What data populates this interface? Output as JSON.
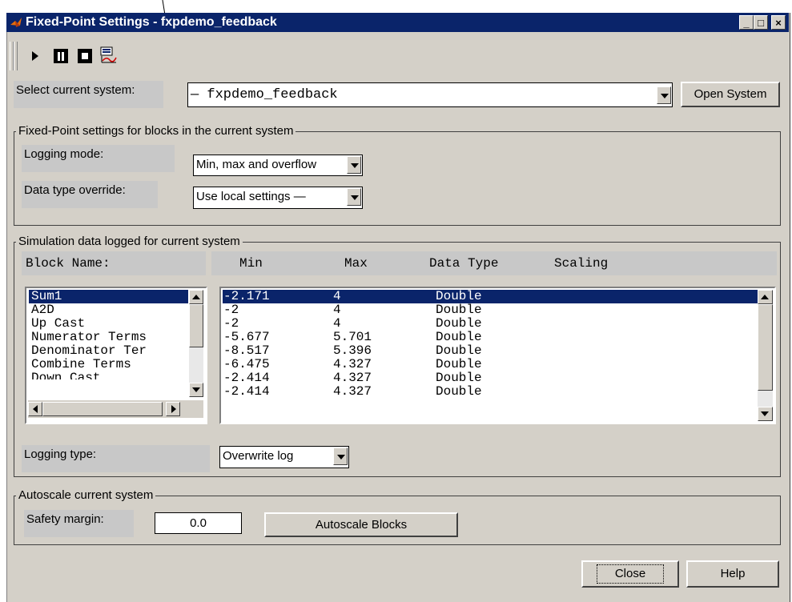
{
  "window": {
    "title": "Fixed-Point Settings - fxpdemo_feedback",
    "controls": [
      "_",
      "□",
      "×"
    ]
  },
  "toolbar": {
    "icons": [
      "play-icon",
      "pause-icon",
      "stop-icon",
      "plot-icon"
    ]
  },
  "system": {
    "label": "Select current system:",
    "value": "— fxpdemo_feedback",
    "open_button": "Open System"
  },
  "fixed_point_group": {
    "title": "Fixed-Point settings for blocks in the current system",
    "logging_mode_label": "Logging mode:",
    "logging_mode_value": "Min, max and overflow",
    "override_label": "Data type override:",
    "override_value": "Use local settings —"
  },
  "simulation_group": {
    "title": "Simulation data logged for current system",
    "block_name_header": "Block Name:",
    "columns": [
      "Min",
      "Max",
      "Data Type",
      "Scaling"
    ],
    "blocks": [
      "Sum1",
      "A2D",
      "Up Cast",
      "Numerator Terms",
      "Denominator Ter",
      "Combine Terms",
      "Down Cast"
    ],
    "rows": [
      {
        "min": "-2.171",
        "max": "4",
        "type": "Double"
      },
      {
        "min": "-2",
        "max": "4",
        "type": "Double"
      },
      {
        "min": "-2",
        "max": "4",
        "type": "Double"
      },
      {
        "min": "-5.677",
        "max": "5.701",
        "type": "Double"
      },
      {
        "min": "-8.517",
        "max": "5.396",
        "type": "Double"
      },
      {
        "min": "-6.475",
        "max": "4.327",
        "type": "Double"
      },
      {
        "min": "-2.414",
        "max": "4.327",
        "type": "Double"
      },
      {
        "min": "-2.414",
        "max": "4.327",
        "type": "Double"
      }
    ],
    "logging_type_label": "Logging type:",
    "logging_type_value": "Overwrite log"
  },
  "autoscale_group": {
    "title": "Autoscale current system",
    "safety_label": "Safety margin:",
    "safety_value": "0.0",
    "autoscale_button": "Autoscale Blocks"
  },
  "footer": {
    "close_button": "Close",
    "help_button": "Help"
  },
  "colors": {
    "titlebar": "#0a246a",
    "face": "#d4d0c8",
    "selection": "#0a246a"
  }
}
